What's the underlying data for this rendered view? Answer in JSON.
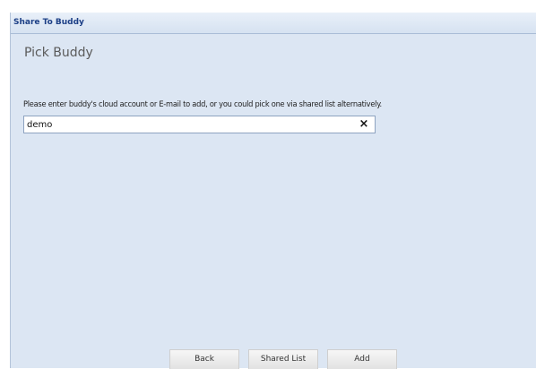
{
  "window": {
    "title": "Share To Buddy"
  },
  "main": {
    "heading": "Pick Buddy",
    "instruction": "Please enter buddy's cloud account or E-mail to add, or you could pick one via shared list alternatively.",
    "buddy_input": {
      "value": "demo",
      "placeholder": ""
    },
    "clear_label": "×"
  },
  "footer": {
    "back_label": "Back",
    "shared_list_label": "Shared List",
    "add_label": "Add"
  },
  "colors": {
    "title_text": "#1c3f86",
    "dialog_background": "#dce6f3"
  }
}
